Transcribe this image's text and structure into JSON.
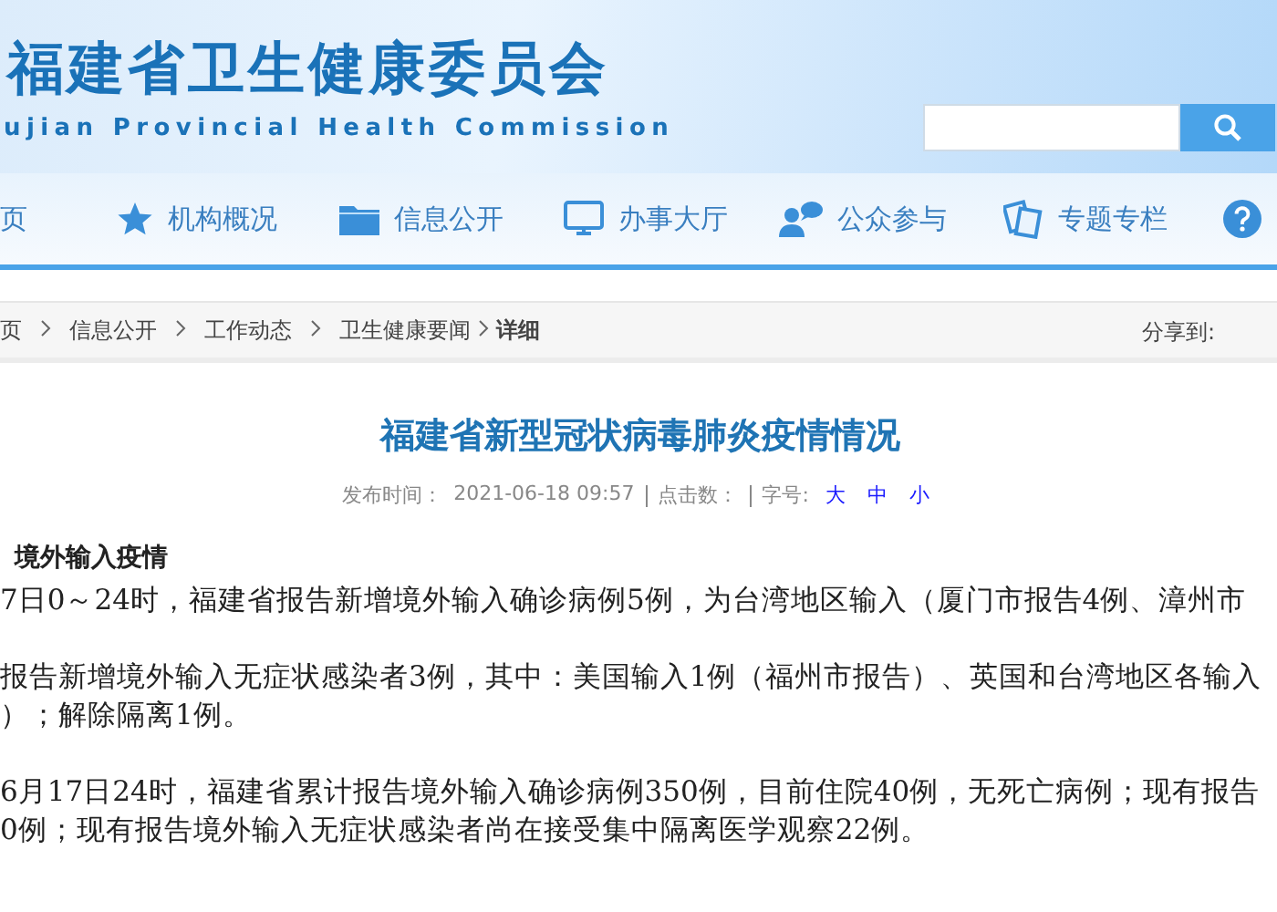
{
  "header": {
    "title": "福建省卫生健康委员会",
    "subtitle": "ujian Provincial Health Commission"
  },
  "nav": [
    {
      "label": "页"
    },
    {
      "label": "机构概况"
    },
    {
      "label": "信息公开"
    },
    {
      "label": "办事大厅"
    },
    {
      "label": "公众参与"
    },
    {
      "label": "专题专栏"
    }
  ],
  "breadcrumb": {
    "items": [
      {
        "label": "页",
        "current": false
      },
      {
        "label": "信息公开",
        "current": false
      },
      {
        "label": "工作动态",
        "current": false
      },
      {
        "label": "卫生健康要闻",
        "current": false
      },
      {
        "label": "详细",
        "current": true
      }
    ],
    "share": "分享到:"
  },
  "article": {
    "title": "福建省新型冠状病毒肺炎疫情情况",
    "meta": {
      "published_label": "发布时间：",
      "published": "2021-06-18 09:57",
      "clicks_label": "点击数：",
      "font_label": "字号:",
      "font_sizes": [
        "大",
        "中",
        "小"
      ]
    },
    "heading": "境外输入疫情",
    "paragraphs": [
      [
        "7日0～24时，福建省报告新增境外输入确诊病例5例，为台湾地区输入（厦门市报告4例、漳州市"
      ],
      [
        "报告新增境外输入无症状感染者3例，其中：美国输入1例（福州市报告）、英国和台湾地区各输入",
        "）；解除隔离1例。"
      ],
      [
        "6月17日24时，福建省累计报告境外输入确诊病例350例，目前住院40例，无死亡病例；现有报告",
        "0例；现有报告境外输入无症状感染者尚在接受集中隔离医学观察22例。"
      ]
    ]
  }
}
